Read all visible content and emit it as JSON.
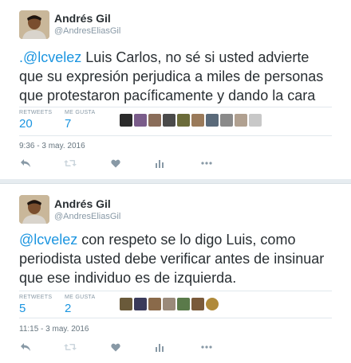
{
  "tweets": [
    {
      "author_name": "Andrés Gil",
      "author_handle": "@AndresEliasGil",
      "text_line1_mention": ".@lcvelez",
      "text_line1_rest": " Luis Carlos, no sé si usted advierte",
      "text_line2": "que su expresión perjudica a  miles de personas",
      "text_line3": "que protestaron pacíficamente y dando la cara",
      "retweets_label": "RETWEETS",
      "retweets_count": "20",
      "likes_label": "ME GUSTA",
      "likes_count": "7",
      "timestamp": "9:36 - 3 may. 2016",
      "liker_colors": [
        "#2b2b2b",
        "#7a5c8a",
        "#8a6d5a",
        "#4a4a4a",
        "#6b6b3a",
        "#9a7a5a",
        "#5a6a7a",
        "#8a8a8a",
        "#b0a090",
        "#c8c8c8"
      ]
    },
    {
      "author_name": "Andrés Gil",
      "author_handle": "@AndresEliasGil",
      "text_line1_mention": "@lcvelez",
      "text_line1_rest": " con respeto se lo digo Luis, como",
      "text_line2": "periodista usted debe verificar antes de insinuar",
      "text_line3": "que ese individuo es de izquierda.",
      "retweets_label": "RETWEETS",
      "retweets_count": "5",
      "likes_label": "ME GUSTA",
      "likes_count": "2",
      "timestamp": "11:15 - 3 may. 2016",
      "liker_colors": [
        "#6a5a3a",
        "#3a3a5a",
        "#8a6a4a",
        "#9a8a7a",
        "#5a7a4a",
        "#7a5a3a",
        "#b08a3a"
      ]
    }
  ],
  "actions": {
    "reply_icon": "reply-icon",
    "retweet_icon": "retweet-icon",
    "like_icon": "heart-icon",
    "analytics_icon": "analytics-icon",
    "more_icon": "more-icon"
  },
  "colors": {
    "link": "#1b95e0",
    "muted": "#8899a6",
    "text": "#292f33",
    "background": "#e6ecf0"
  }
}
